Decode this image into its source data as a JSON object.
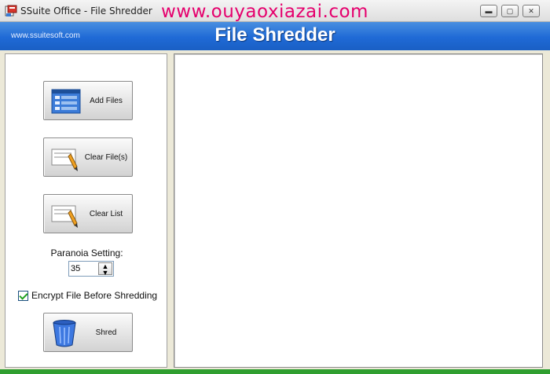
{
  "window": {
    "title": "SSuite Office - File Shredder",
    "watermark": "www.ouyaoxiazai.com",
    "controls": {
      "minimize": "▬",
      "maximize": "▢",
      "close": "✕"
    }
  },
  "banner": {
    "url": "www.ssuitesoft.com",
    "title": "File Shredder"
  },
  "left_panel": {
    "add_files_label": "Add Files",
    "clear_files_label": "Clear File(s)",
    "clear_list_label": "Clear List",
    "paranoia_label": "Paranoia Setting:",
    "paranoia_value": "35",
    "encrypt_label": "Encrypt File Before Shredding",
    "encrypt_checked": true,
    "shred_label": "Shred"
  },
  "colors": {
    "banner": "#1f6ad6",
    "watermark": "#e5006d",
    "status_bar": "#2f9e2f"
  }
}
